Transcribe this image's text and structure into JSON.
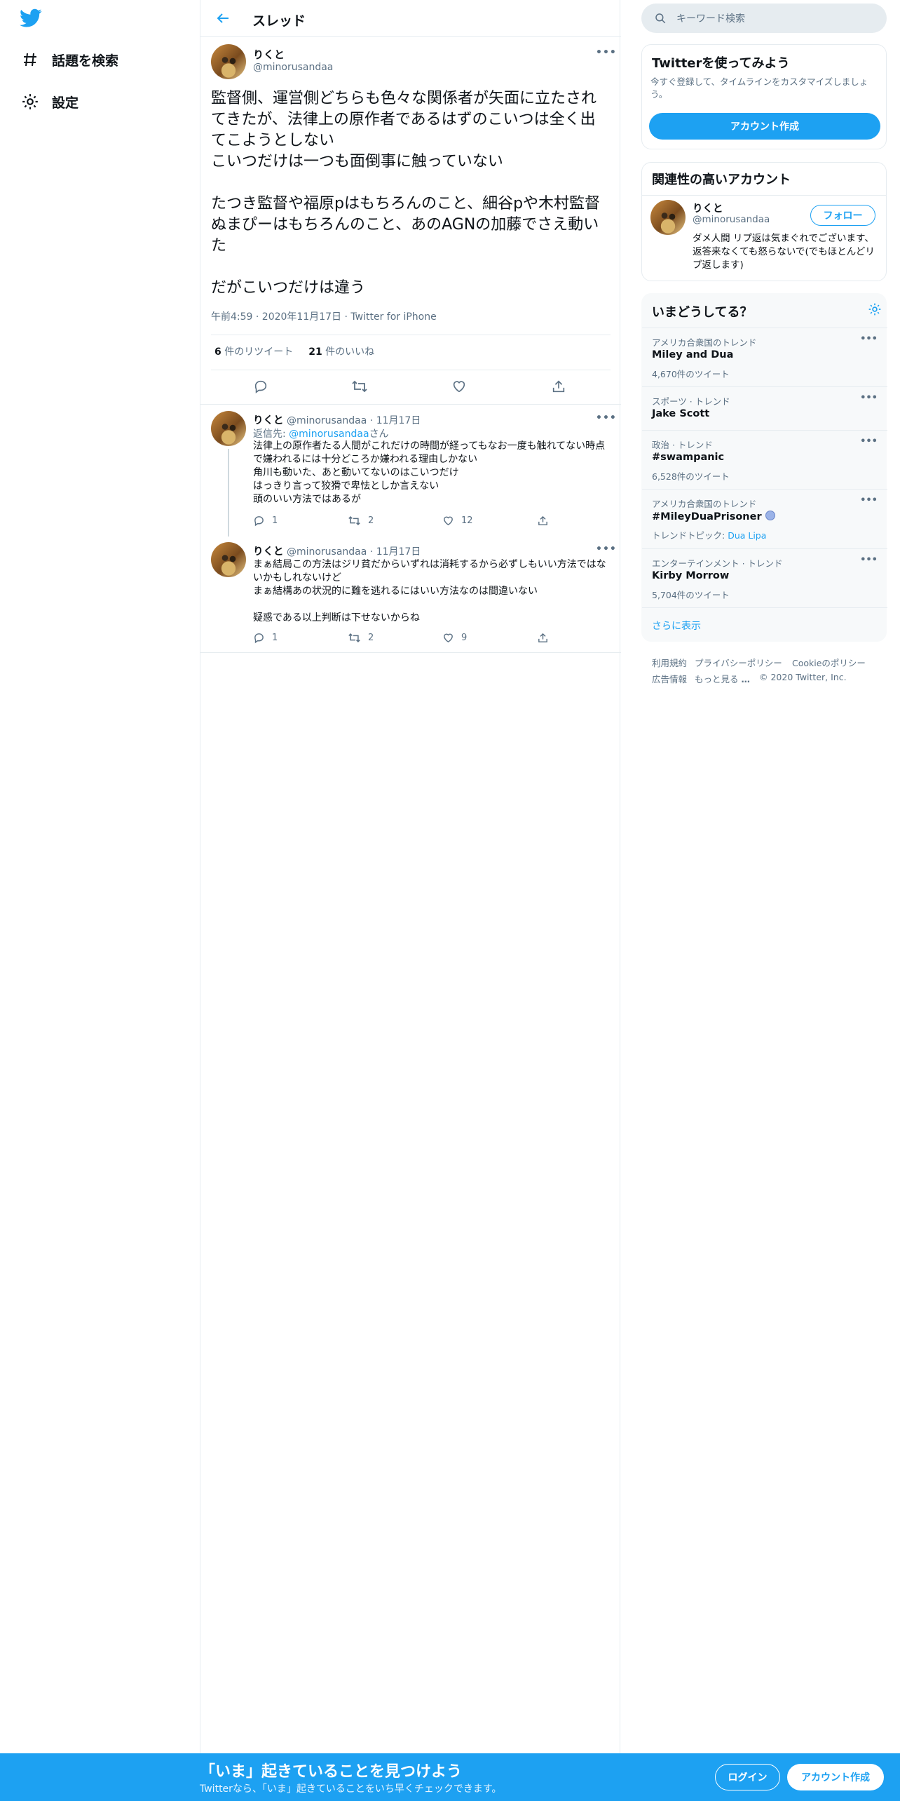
{
  "nav": {
    "explore_label": "話題を検索",
    "settings_label": "設定"
  },
  "header": {
    "title": "スレッド"
  },
  "main_tweet": {
    "name": "りくと",
    "handle": "@minorusandaa",
    "text": "監督側、運営側どちらも色々な関係者が矢面に立たされてきたが、法律上の原作者であるはずのこいつは全く出てこようとしない\nこいつだけは一つも面倒事に触っていない\n\nたつき監督や福原pはもちろんのこと、細谷pや木村監督ぬまぴーはもちろんのこと、あのAGNの加藤でさえ動いた\n\nだがこいつだけは違う",
    "meta": "午前4:59 · 2020年11月17日 · Twitter for iPhone",
    "retweets_count": "6",
    "retweets_label": "件のリツイート",
    "likes_count": "21",
    "likes_label": "件のいいね"
  },
  "replies": [
    {
      "name": "りくと",
      "handle": "@minorusandaa",
      "date": "· 11月17日",
      "reply_to_prefix": "返信先: ",
      "reply_to_handle": "@minorusandaa",
      "reply_to_suffix": "さん",
      "text": "法律上の原作者たる人間がこれだけの時間が経ってもなお一度も触れてない時点で嫌われるには十分どころか嫌われる理由しかない\n角川も動いた、あと動いてないのはこいつだけ\nはっきり言って狡猾で卑怯としか言えない\n頭のいい方法ではあるが",
      "replies": "1",
      "retweets": "2",
      "likes": "12"
    },
    {
      "name": "りくと",
      "handle": "@minorusandaa",
      "date": "· 11月17日",
      "text": "まぁ結局この方法はジリ貧だからいずれは消耗するから必ずしもいい方法ではないかもしれないけど\nまぁ結構あの状況的に難を逃れるにはいい方法なのは間違いない\n\n疑惑である以上判断は下せないからね",
      "replies": "1",
      "retweets": "2",
      "likes": "9"
    }
  ],
  "search": {
    "placeholder": "キーワード検索"
  },
  "signup_card": {
    "title": "Twitterを使ってみよう",
    "description": "今すぐ登録して、タイムラインをカスタマイズしましょう。",
    "button": "アカウント作成"
  },
  "related_card": {
    "title": "関連性の高いアカウント",
    "name": "りくと",
    "handle": "@minorusandaa",
    "follow_label": "フォロー",
    "bio": "ダメ人間 リプ返は気まぐれでございます、返答来なくても怒らないで(でもほとんどリプ返します)"
  },
  "trends_card": {
    "title": "いまどうしてる？",
    "items": [
      {
        "category": "アメリカ合衆国のトレンド",
        "title": "Miley and Dua",
        "count": "4,670件のツイート"
      },
      {
        "category": "スポーツ · トレンド",
        "title": "Jake Scott",
        "count": ""
      },
      {
        "category": "政治 · トレンド",
        "title": "#swampanic",
        "count": "6,528件のツイート"
      },
      {
        "category": "アメリカ合衆国のトレンド",
        "title": "#MileyDuaPrisoner",
        "topic_prefix": "トレンドトピック: ",
        "topic": "Dua Lipa"
      },
      {
        "category": "エンターテインメント · トレンド",
        "title": "Kirby Morrow",
        "count": "5,704件のツイート"
      }
    ],
    "show_more": "さらに表示"
  },
  "footer": {
    "terms": "利用規約",
    "privacy": "プライバシーポリシー",
    "cookie": "Cookieのポリシー",
    "ads": "広告情報",
    "more": "もっと見る",
    "copyright": "© 2020 Twitter, Inc."
  },
  "bottom_bar": {
    "headline": "「いま」起きていることを見つけよう",
    "subtext": "Twitterなら、「いま」起きていることをいち早くチェックできます。",
    "login": "ログイン",
    "signup": "アカウント作成"
  },
  "colors": {
    "accent": "#1da1f2",
    "text": "#0f1419",
    "secondary": "#5b7083",
    "border": "#e6ecf0"
  }
}
